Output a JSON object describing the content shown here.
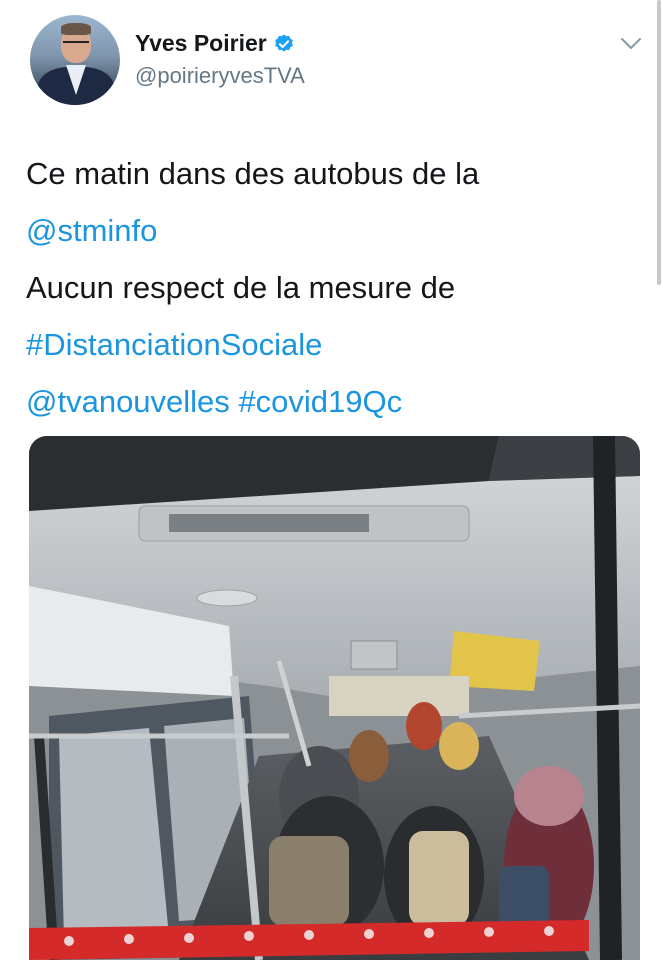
{
  "author": {
    "name": "Yves Poirier",
    "handle": "@poirieryvesTVA",
    "verified": true
  },
  "tweet": {
    "lines": [
      [
        {
          "text": "Ce matin dans des autobus de la",
          "type": "text"
        }
      ],
      [
        {
          "text": "@stminfo",
          "type": "link"
        }
      ],
      [
        {
          "text": "Aucun respect de la mesure de",
          "type": "text"
        }
      ],
      [
        {
          "text": "#DistanciationSociale",
          "type": "link"
        }
      ],
      [
        {
          "text": "@tvanouvelles",
          "type": "link"
        },
        {
          "text": " ",
          "type": "text"
        },
        {
          "text": "#covid19Qc",
          "type": "link"
        }
      ]
    ]
  },
  "colors": {
    "link": "#1b95e0",
    "text": "#14171a",
    "secondary": "#657786",
    "verified": "#1da1f2"
  },
  "icons": {
    "verified": "verified-badge-icon",
    "menu": "chevron-down-icon"
  }
}
